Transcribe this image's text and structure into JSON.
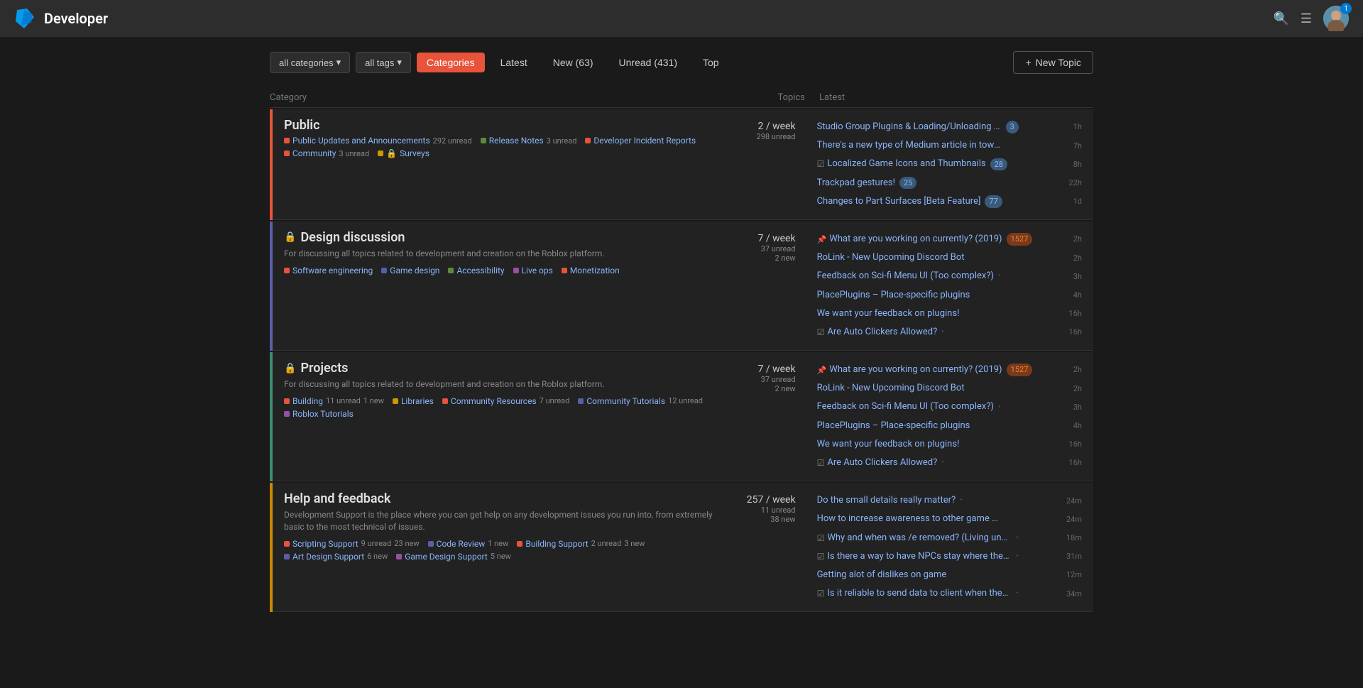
{
  "header": {
    "title": "Developer",
    "nav_icon_search": "🔍",
    "nav_icon_menu": "☰",
    "avatar_text": "",
    "notification_count": "1"
  },
  "toolbar": {
    "filter_categories_label": "all categories",
    "filter_tags_label": "all tags",
    "tabs": [
      {
        "id": "categories",
        "label": "Categories",
        "active": true
      },
      {
        "id": "latest",
        "label": "Latest",
        "active": false
      },
      {
        "id": "new",
        "label": "New (63)",
        "active": false
      },
      {
        "id": "unread",
        "label": "Unread (431)",
        "active": false
      },
      {
        "id": "top",
        "label": "Top",
        "active": false
      }
    ],
    "new_topic_label": "+ New Topic"
  },
  "table": {
    "col_category": "Category",
    "col_topics": "Topics",
    "col_latest": "Latest"
  },
  "categories": [
    {
      "id": "public",
      "name": "Public",
      "color": "#e8533a",
      "locked": false,
      "stats": "2 / week",
      "stats_sub": "298 unread",
      "description": "",
      "subcats": [
        {
          "name": "Public Updates and Announcements",
          "color": "#e8533a",
          "unread": "292 unread",
          "new": ""
        },
        {
          "name": "Release Notes",
          "color": "#5b8a3c",
          "unread": "3 unread",
          "new": ""
        },
        {
          "name": "Developer Incident Reports",
          "color": "#e8533a",
          "unread": "",
          "new": ""
        },
        {
          "name": "Community",
          "color": "#e8533a",
          "unread": "3 unread",
          "new": ""
        },
        {
          "name": "& Surveys",
          "color": "#cc9900",
          "unread": "",
          "new": ""
        }
      ],
      "topics": [
        {
          "title": "Studio Group Plugins & Loading/Unloading Improvements",
          "badge": "3",
          "time": "1h",
          "pinned": false,
          "prefix": false
        },
        {
          "title": "There's a new type of Medium article in town! 😺",
          "badge": "",
          "time": "7h",
          "pinned": false,
          "prefix": false
        },
        {
          "title": "Localized Game Icons and Thumbnails",
          "badge": "28",
          "time": "8h",
          "pinned": false,
          "prefix": true
        },
        {
          "title": "Trackpad gestures!",
          "badge": "25",
          "time": "22h",
          "pinned": false,
          "prefix": false
        },
        {
          "title": "Changes to Part Surfaces [Beta Feature]",
          "badge": "77",
          "time": "1d",
          "pinned": false,
          "prefix": false
        }
      ]
    },
    {
      "id": "design",
      "name": "Design discussion",
      "color": "#5b5ea6",
      "locked": true,
      "stats": "7 / week",
      "stats_sub": "37 unread",
      "stats_sub2": "2 new",
      "description": "For discussing all topics related to development and creation on the Roblox platform.",
      "subcats": [
        {
          "name": "Software engineering",
          "color": "#e8533a",
          "unread": "",
          "new": ""
        },
        {
          "name": "Game design",
          "color": "#5b5ea6",
          "unread": "",
          "new": ""
        },
        {
          "name": "Accessibility",
          "color": "#5b8a3c",
          "unread": "",
          "new": ""
        },
        {
          "name": "Live ops",
          "color": "#9b4ea6",
          "unread": "",
          "new": ""
        },
        {
          "name": "Monetization",
          "color": "#e8533a",
          "unread": "",
          "new": ""
        }
      ],
      "topics": [
        {
          "title": "What are you working on currently? (2019)",
          "badge": "1527",
          "badge_type": "orange",
          "time": "2h",
          "pinned": true,
          "prefix": false
        },
        {
          "title": "RoLink - New Upcoming Discord Bot",
          "badge": "",
          "time": "2h",
          "pinned": false,
          "prefix": false
        },
        {
          "title": "Feedback on Sci-fi Menu UI (Too complex?)",
          "badge": "",
          "time": "3h",
          "pinned": false,
          "prefix": false,
          "dot": true
        },
        {
          "title": "PlacePlugins – Place-specific plugins",
          "badge": "",
          "time": "4h",
          "pinned": false,
          "prefix": false
        },
        {
          "title": "We want your feedback on plugins!",
          "badge": "",
          "time": "16h",
          "pinned": false,
          "prefix": false
        },
        {
          "title": "Are Auto Clickers Allowed?",
          "badge": "",
          "time": "16h",
          "pinned": false,
          "prefix": true,
          "dot": true
        }
      ]
    },
    {
      "id": "projects",
      "name": "Projects",
      "color": "#3e8c6e",
      "locked": true,
      "stats": "7 / week",
      "stats_sub": "37 unread",
      "stats_sub2": "2 new",
      "description": "For discussing all topics related to development and creation on the Roblox platform.",
      "subcats": [
        {
          "name": "Building",
          "color": "#e8533a",
          "unread": "11 unread",
          "new": "1 new"
        },
        {
          "name": "Libraries",
          "color": "#cc9900",
          "unread": "",
          "new": ""
        },
        {
          "name": "Community Resources",
          "color": "#e8533a",
          "unread": "7 unread",
          "new": ""
        },
        {
          "name": "Community Tutorials",
          "color": "#5b5ea6",
          "unread": "12 unread",
          "new": ""
        },
        {
          "name": "Roblox Tutorials",
          "color": "#9b4ea6",
          "unread": "",
          "new": ""
        }
      ],
      "topics": [
        {
          "title": "What are you working on currently? (2019)",
          "badge": "1527",
          "badge_type": "orange",
          "time": "2h",
          "pinned": true,
          "prefix": false
        },
        {
          "title": "RoLink - New Upcoming Discord Bot",
          "badge": "",
          "time": "2h",
          "pinned": false,
          "prefix": false
        },
        {
          "title": "Feedback on Sci-fi Menu UI (Too complex?)",
          "badge": "",
          "time": "3h",
          "pinned": false,
          "prefix": false,
          "dot": true
        },
        {
          "title": "PlacePlugins – Place-specific plugins",
          "badge": "",
          "time": "4h",
          "pinned": false,
          "prefix": false
        },
        {
          "title": "We want your feedback on plugins!",
          "badge": "",
          "time": "16h",
          "pinned": false,
          "prefix": false
        },
        {
          "title": "Are Auto Clickers Allowed?",
          "badge": "",
          "time": "16h",
          "pinned": false,
          "prefix": true,
          "dot": true
        }
      ]
    },
    {
      "id": "help",
      "name": "Help and feedback",
      "color": "#cc8800",
      "locked": false,
      "stats": "257 / week",
      "stats_sub": "11 unread",
      "stats_sub2": "38 new",
      "description": "Development Support is the place where you can get help on any development issues you run into, from extremely basic to the most technical of issues.",
      "subcats": [
        {
          "name": "Scripting Support",
          "color": "#e8533a",
          "unread": "9 unread",
          "new": "23 new"
        },
        {
          "name": "Code Review",
          "color": "#5b5ea6",
          "unread": "",
          "new": "1 new"
        },
        {
          "name": "Building Support",
          "color": "#e8533a",
          "unread": "2 unread",
          "new": "3 new"
        },
        {
          "name": "Art Design Support",
          "color": "#5b5ea6",
          "unread": "",
          "new": "6 new"
        },
        {
          "name": "Game Design Support",
          "color": "#9b4ea6",
          "unread": "",
          "new": "5 new"
        }
      ],
      "topics": [
        {
          "title": "Do the small details really matter?",
          "badge": "",
          "time": "24m",
          "pinned": false,
          "prefix": false,
          "dot": true
        },
        {
          "title": "How to increase awareness to other game modes",
          "badge": "",
          "time": "24m",
          "pinned": false,
          "prefix": false
        },
        {
          "title": "Why and when was /e removed? (Living under a rock)",
          "badge": "",
          "time": "18m",
          "pinned": false,
          "prefix": true,
          "dot": true
        },
        {
          "title": "Is there a way to have NPCs stay where they are when animatio...",
          "badge": "",
          "time": "31m",
          "pinned": false,
          "prefix": true,
          "dot": true
        },
        {
          "title": "Getting alot of dislikes on game",
          "badge": "",
          "time": "12m",
          "pinned": false,
          "prefix": false
        },
        {
          "title": "Is it reliable to send data to client when they first join?",
          "badge": "",
          "time": "34m",
          "pinned": false,
          "prefix": true,
          "dot": true
        }
      ]
    }
  ]
}
